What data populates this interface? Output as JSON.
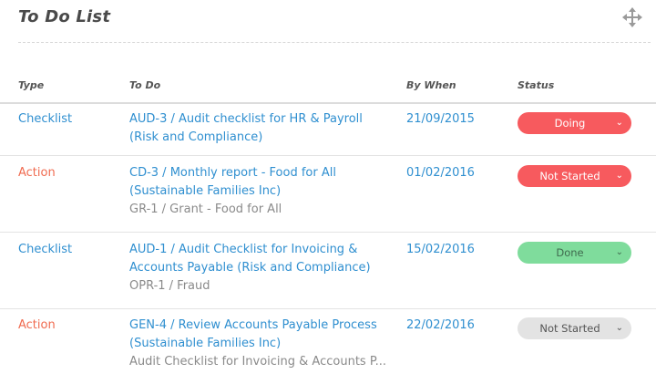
{
  "header": {
    "title": "To Do List"
  },
  "columns": {
    "type": "Type",
    "todo": "To Do",
    "by_when": "By When",
    "status": "Status"
  },
  "rows": [
    {
      "type": "Checklist",
      "todo_line1": "AUD-3 / Audit checklist for HR & Payroll",
      "todo_line2": "(Risk and Compliance)",
      "sub": "",
      "date": "21/09/2015",
      "status": "Doing"
    },
    {
      "type": "Action",
      "todo_line1": "CD-3 / Monthly report - Food for All",
      "todo_line2": "(Sustainable Families Inc)",
      "sub": "GR-1 / Grant - Food for All",
      "date": "01/02/2016",
      "status": "Not Started"
    },
    {
      "type": "Checklist",
      "todo_line1": "AUD-1 / Audit Checklist for Invoicing &",
      "todo_line2": "Accounts Payable (Risk and Compliance)",
      "sub": "OPR-1 / Fraud",
      "date": "15/02/2016",
      "status": "Done"
    },
    {
      "type": "Action",
      "todo_line1": "GEN-4 / Review Accounts Payable Process",
      "todo_line2": "(Sustainable Families Inc)",
      "sub": "Audit Checklist for Invoicing & Accounts P...",
      "date": "22/02/2016",
      "status": "Not Started"
    }
  ],
  "colors": {
    "link_blue": "#2f8fd0",
    "action_orange": "#f06b50",
    "status_red": "#f75a5e",
    "status_green": "#7fdc9c",
    "status_grey": "#e3e3e3"
  },
  "icons": {
    "move": "move-arrows-icon",
    "chevron": "chevron-down-icon"
  }
}
